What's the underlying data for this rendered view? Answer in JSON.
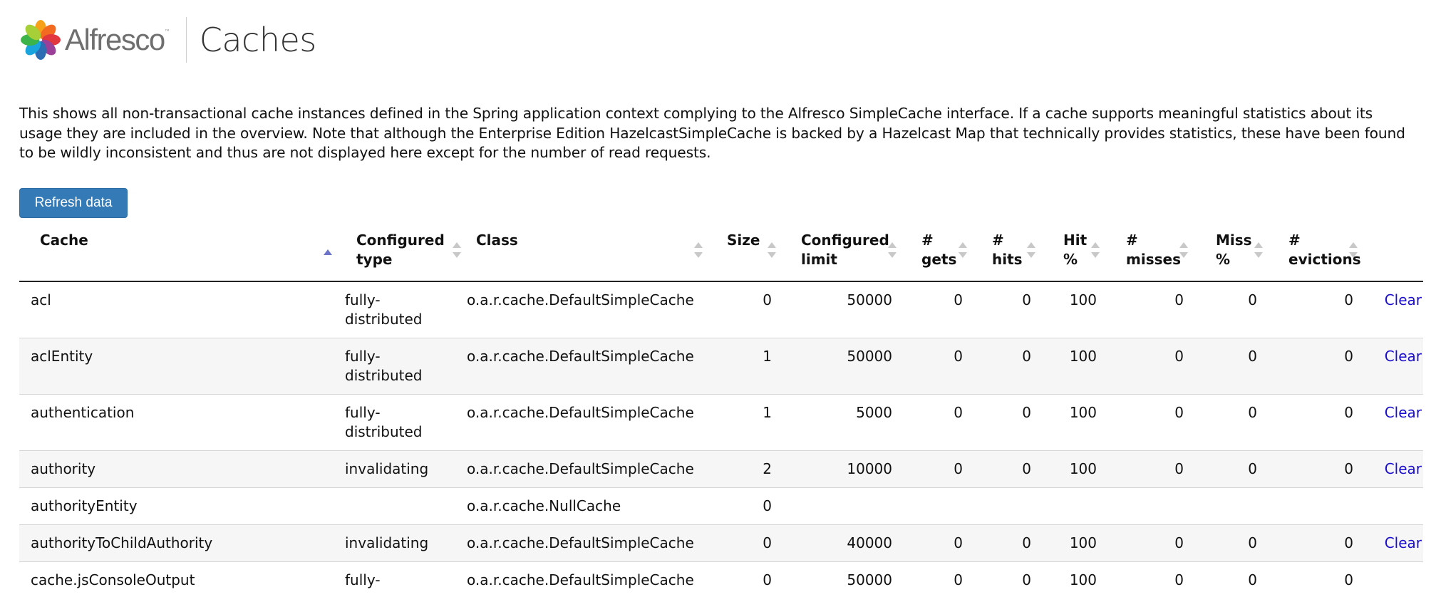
{
  "brand": {
    "name": "Alfresco"
  },
  "page": {
    "title": "Caches"
  },
  "description": "This shows all non-transactional cache instances defined in the Spring application context complying to the Alfresco SimpleCache interface. If a cache supports meaningful statistics about its usage they are included in the overview. Note that although the Enterprise Edition HazelcastSimpleCache is backed by a Hazelcast Map that technically provides statistics, these have been found to be wildly inconsistent and thus are not displayed here except for the number of read requests.",
  "toolbar": {
    "refresh_label": "Refresh data"
  },
  "colors": {
    "accent": "#337ab7",
    "link": "#1a0dcc",
    "sort_active": "#6b74c9",
    "sort_inactive": "#c8c8c8"
  },
  "table": {
    "columns": [
      "Cache",
      "Configured type",
      "Class",
      "Size",
      "Configured limit",
      "# gets",
      "# hits",
      "Hit %",
      "# misses",
      "Miss %",
      "# evictions",
      ""
    ],
    "sorted_column": "Cache",
    "sort_direction": "ascending",
    "rows": [
      {
        "cache": "acl",
        "type": "fully-distributed",
        "class": "o.a.r.cache.DefaultSimpleCache",
        "size": "0",
        "limit": "50000",
        "gets": "0",
        "hits": "0",
        "hit_pct": "100",
        "misses": "0",
        "miss_pct": "0",
        "evictions": "0",
        "action": "Clear"
      },
      {
        "cache": "aclEntity",
        "type": "fully-distributed",
        "class": "o.a.r.cache.DefaultSimpleCache",
        "size": "1",
        "limit": "50000",
        "gets": "0",
        "hits": "0",
        "hit_pct": "100",
        "misses": "0",
        "miss_pct": "0",
        "evictions": "0",
        "action": "Clear"
      },
      {
        "cache": "authentication",
        "type": "fully-distributed",
        "class": "o.a.r.cache.DefaultSimpleCache",
        "size": "1",
        "limit": "5000",
        "gets": "0",
        "hits": "0",
        "hit_pct": "100",
        "misses": "0",
        "miss_pct": "0",
        "evictions": "0",
        "action": "Clear"
      },
      {
        "cache": "authority",
        "type": "invalidating",
        "class": "o.a.r.cache.DefaultSimpleCache",
        "size": "2",
        "limit": "10000",
        "gets": "0",
        "hits": "0",
        "hit_pct": "100",
        "misses": "0",
        "miss_pct": "0",
        "evictions": "0",
        "action": "Clear"
      },
      {
        "cache": "authorityEntity",
        "type": "",
        "class": "o.a.r.cache.NullCache",
        "size": "0",
        "limit": "",
        "gets": "",
        "hits": "",
        "hit_pct": "",
        "misses": "",
        "miss_pct": "",
        "evictions": "",
        "action": ""
      },
      {
        "cache": "authorityToChildAuthority",
        "type": "invalidating",
        "class": "o.a.r.cache.DefaultSimpleCache",
        "size": "0",
        "limit": "40000",
        "gets": "0",
        "hits": "0",
        "hit_pct": "100",
        "misses": "0",
        "miss_pct": "0",
        "evictions": "0",
        "action": "Clear"
      },
      {
        "cache": "cache.jsConsoleOutput",
        "type": "fully-",
        "class": "o.a.r.cache.DefaultSimpleCache",
        "size": "0",
        "limit": "50000",
        "gets": "0",
        "hits": "0",
        "hit_pct": "100",
        "misses": "0",
        "miss_pct": "0",
        "evictions": "0",
        "action": ""
      }
    ]
  }
}
